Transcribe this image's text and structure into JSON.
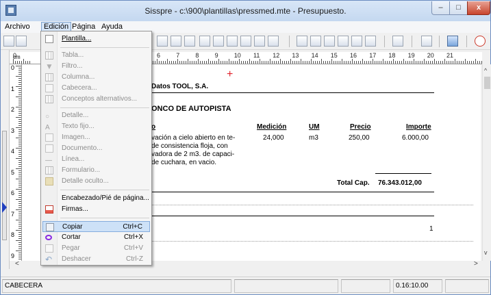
{
  "title": "Sisspre - c:\\900\\plantillas\\pressmed.mte - Presupuesto.",
  "window_controls": {
    "minimize": "–",
    "maximize": "□",
    "close": "x"
  },
  "menubar": [
    "Archivo",
    "Edición",
    "Página",
    "Ayuda"
  ],
  "ruler": {
    "unit": "cm",
    "h_numbers": [
      "0",
      "6",
      "7",
      "8",
      "9",
      "10",
      "11",
      "12",
      "13",
      "14",
      "15",
      "16",
      "17",
      "18",
      "19",
      "20",
      "21"
    ],
    "v_numbers": [
      "0",
      "1",
      "2",
      "3",
      "4",
      "5",
      "6",
      "7",
      "8",
      "9"
    ]
  },
  "document": {
    "company": "Datos TOOL, S.A.",
    "section_title": "ONCO DE AUTOPISTA",
    "col_short": "o",
    "col_medicion": "Medición",
    "col_um": "UM",
    "col_precio": "Precio",
    "col_importe": "Importe",
    "desc_lines": [
      "vación a cielo abierto en te-",
      " de consistencia floja, con",
      "vadora de 2 m3. de capaci-",
      "de cuchara, en vacio."
    ],
    "medicion": "24,000",
    "um": "m3",
    "precio": "250,00",
    "importe": "6.000,00",
    "total_label": "Total Cap.",
    "total_value": "76.343.012,00",
    "page_number": "1"
  },
  "dropdown": {
    "items": [
      {
        "label": "Plantilla...",
        "icon": "template-icon",
        "disabled": false
      },
      {
        "label": "Tabla...",
        "icon": "table-icon",
        "disabled": true
      },
      {
        "label": "Filtro...",
        "icon": "filter-icon",
        "disabled": true
      },
      {
        "label": "Columna...",
        "icon": "column-icon",
        "disabled": true
      },
      {
        "label": "Cabecera...",
        "icon": "header-icon",
        "disabled": true
      },
      {
        "label": "Conceptos alternativos...",
        "icon": "alt-concepts-icon",
        "disabled": true
      },
      {
        "label": "Detalle...",
        "icon": "detail-icon",
        "disabled": true
      },
      {
        "label": "Texto fijo...",
        "icon": "fixed-text-icon",
        "disabled": true
      },
      {
        "label": "Imagen...",
        "icon": "image-icon",
        "disabled": true
      },
      {
        "label": "Documento...",
        "icon": "document-icon",
        "disabled": true
      },
      {
        "label": "Línea...",
        "icon": "line-icon",
        "disabled": true
      },
      {
        "label": "Formulario...",
        "icon": "form-icon",
        "disabled": true
      },
      {
        "label": "Detalle oculto...",
        "icon": "hidden-detail-icon",
        "disabled": true
      },
      {
        "label": "Encabezado/Pié de página...",
        "icon": "",
        "disabled": false
      },
      {
        "label": "Firmas...",
        "icon": "signatures-icon",
        "disabled": false
      },
      {
        "label": "Copiar",
        "shortcut": "Ctrl+C",
        "icon": "copy-icon",
        "disabled": false
      },
      {
        "label": "Cortar",
        "shortcut": "Ctrl+X",
        "icon": "cut-icon",
        "disabled": false
      },
      {
        "label": "Pegar",
        "shortcut": "Ctrl+V",
        "icon": "paste-icon",
        "disabled": true
      },
      {
        "label": "Deshacer",
        "shortcut": "Ctrl-Z",
        "icon": "undo-icon",
        "disabled": true
      }
    ]
  },
  "statusbar": {
    "section": "CABECERA",
    "time": "0.16:10.00"
  }
}
